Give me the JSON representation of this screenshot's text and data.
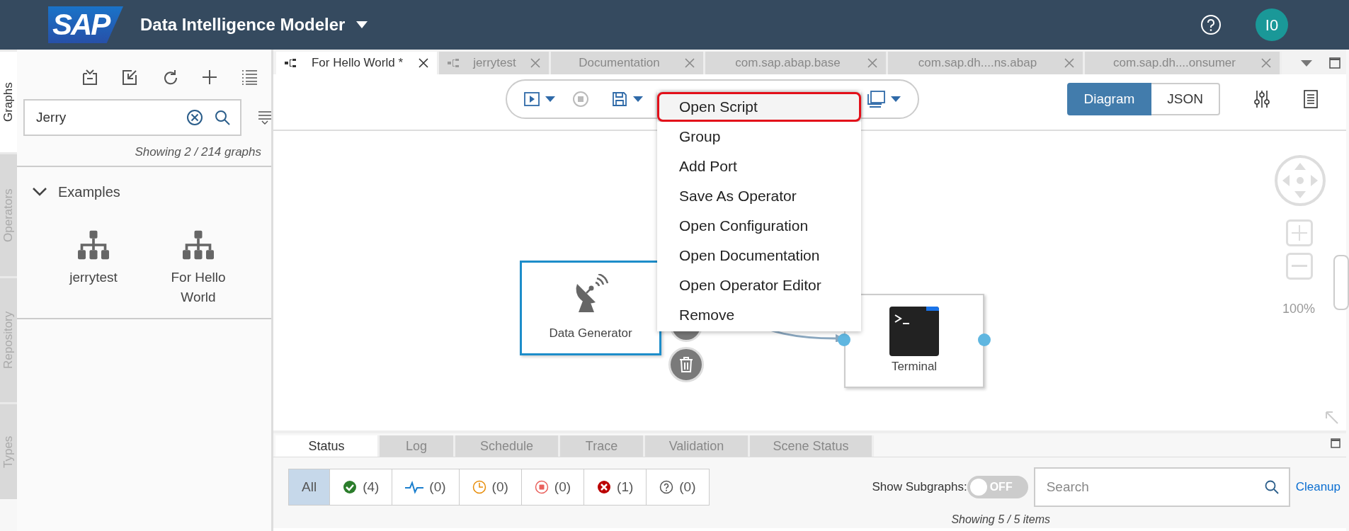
{
  "header": {
    "logo": "SAP",
    "title": "Data Intelligence Modeler",
    "avatar": "I0"
  },
  "side_tabs": [
    {
      "label": "Graphs",
      "selected": true
    },
    {
      "label": "Operators",
      "selected": false
    },
    {
      "label": "Repository",
      "selected": false
    },
    {
      "label": "Types",
      "selected": false
    }
  ],
  "graphs_panel": {
    "search": {
      "value": "Jerry"
    },
    "count": "Showing 2 / 214 graphs",
    "groups": [
      {
        "label": "Examples",
        "expanded": true,
        "items": [
          {
            "label": "jerrytest"
          },
          {
            "label": "For Hello World"
          }
        ]
      }
    ]
  },
  "editor_tabs": [
    {
      "label": "For Hello World *",
      "selected": true,
      "graph_icon": true
    },
    {
      "label": "jerrytest",
      "selected": false,
      "graph_icon": true
    },
    {
      "label": "Documentation",
      "selected": false,
      "graph_icon": false
    },
    {
      "label": "com.sap.abap.base",
      "selected": false,
      "graph_icon": false
    },
    {
      "label": "com.sap.dh....ns.abap",
      "selected": false,
      "graph_icon": false
    },
    {
      "label": "com.sap.dh....onsumer",
      "selected": false,
      "graph_icon": false
    }
  ],
  "view_toggle": [
    {
      "label": "Diagram",
      "selected": true
    },
    {
      "label": "JSON",
      "selected": false
    }
  ],
  "context_menu": [
    {
      "label": "Open Script",
      "selected": true
    },
    {
      "label": "Group",
      "selected": false
    },
    {
      "label": "Add Port",
      "selected": false
    },
    {
      "label": "Save As Operator",
      "selected": false
    },
    {
      "label": "Open Configuration",
      "selected": false
    },
    {
      "label": "Open Documentation",
      "selected": false
    },
    {
      "label": "Open Operator Editor",
      "selected": false
    },
    {
      "label": "Remove",
      "selected": false
    }
  ],
  "nodes": [
    {
      "kind": "generator",
      "label": "Data Generator",
      "selected": true
    },
    {
      "kind": "terminal",
      "label": "Terminal",
      "selected": false
    }
  ],
  "zoom_level": "100%",
  "bottom_tabs": [
    {
      "label": "Status",
      "selected": true
    },
    {
      "label": "Log",
      "selected": false
    },
    {
      "label": "Schedule",
      "selected": false
    },
    {
      "label": "Trace",
      "selected": false
    },
    {
      "label": "Validation",
      "selected": false
    },
    {
      "label": "Scene Status",
      "selected": false
    }
  ],
  "status_filters": [
    {
      "kind": "all",
      "label": "All",
      "selected": true
    },
    {
      "kind": "success",
      "label": "(4)",
      "selected": false
    },
    {
      "kind": "running",
      "label": "(0)",
      "selected": false
    },
    {
      "kind": "pending",
      "label": "(0)",
      "selected": false
    },
    {
      "kind": "stopped",
      "label": "(0)",
      "selected": false
    },
    {
      "kind": "dead",
      "label": "(1)",
      "selected": false
    },
    {
      "kind": "unknown",
      "label": "(0)",
      "selected": false
    }
  ],
  "show_subgraphs": {
    "label": "Show Subgraphs:",
    "on": false,
    "state_text": "OFF"
  },
  "status_search": {
    "placeholder": "Search"
  },
  "cleanup": "Cleanup",
  "items_count": "Showing 5 / 5 items"
}
